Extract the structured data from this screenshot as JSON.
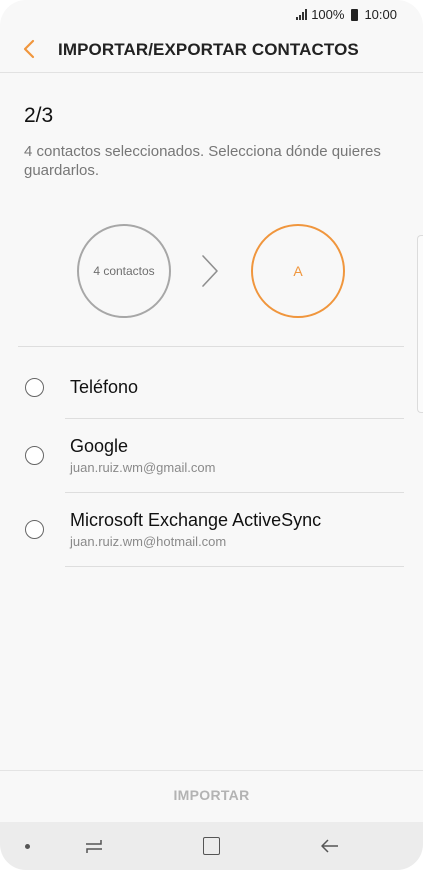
{
  "status": {
    "battery": "100%",
    "time": "10:00",
    "icons": [
      "signal-icon",
      "battery-icon"
    ]
  },
  "header": {
    "title": "IMPORTAR/EXPORTAR CONTACTOS",
    "back_icon": "chevron-left-icon"
  },
  "main": {
    "step": "2/3",
    "description": "4 contactos seleccionados. Selecciona dónde quieres guardarlos.",
    "from_label": "4 contactos",
    "to_label": "A"
  },
  "options": [
    {
      "label": "Teléfono",
      "sub": ""
    },
    {
      "label": "Google",
      "sub": "juan.ruiz.wm@gmail.com"
    },
    {
      "label": "Microsoft Exchange ActiveSync",
      "sub": "juan.ruiz.wm@hotmail.com"
    }
  ],
  "footer": {
    "import_label": "IMPORTAR"
  },
  "navbar": {
    "icons": [
      "dot-icon",
      "recents-icon",
      "home-icon",
      "back-arrow-icon"
    ]
  },
  "colors": {
    "accent": "#f0963d",
    "background": "#f8f8f8",
    "disabled_text": "#b3b3b3"
  }
}
